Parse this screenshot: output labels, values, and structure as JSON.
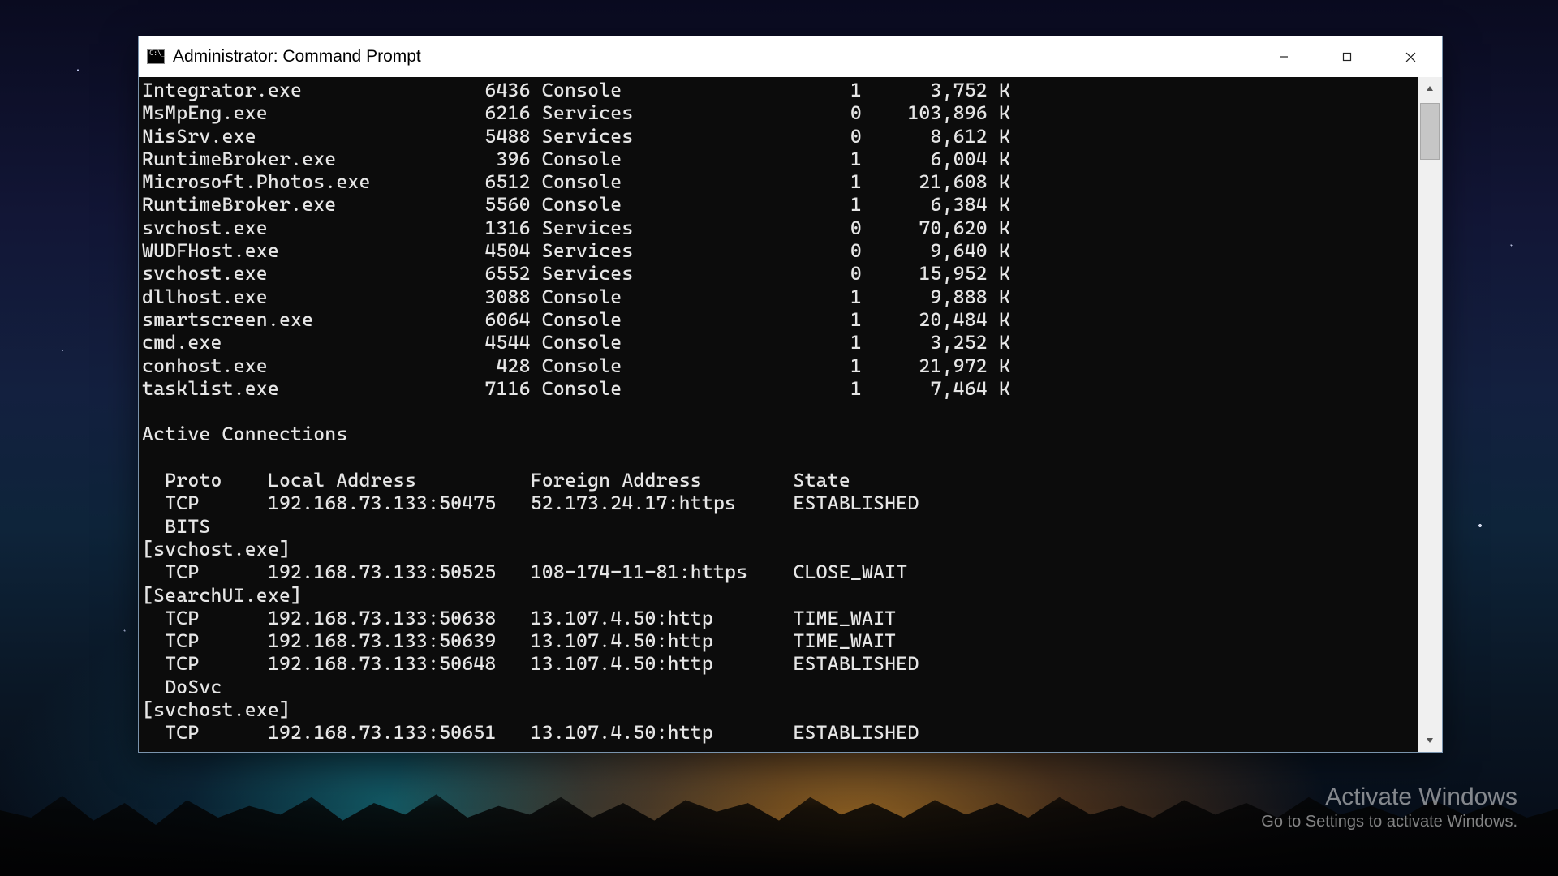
{
  "window": {
    "title": "Administrator: Command Prompt"
  },
  "tasklist": {
    "rows": [
      {
        "name": "Integrator.exe",
        "pid": "6436",
        "session_name": "Console",
        "session_num": "1",
        "mem": "3,752 K"
      },
      {
        "name": "MsMpEng.exe",
        "pid": "6216",
        "session_name": "Services",
        "session_num": "0",
        "mem": "103,896 K"
      },
      {
        "name": "NisSrv.exe",
        "pid": "5488",
        "session_name": "Services",
        "session_num": "0",
        "mem": "8,612 K"
      },
      {
        "name": "RuntimeBroker.exe",
        "pid": "396",
        "session_name": "Console",
        "session_num": "1",
        "mem": "6,004 K"
      },
      {
        "name": "Microsoft.Photos.exe",
        "pid": "6512",
        "session_name": "Console",
        "session_num": "1",
        "mem": "21,608 K"
      },
      {
        "name": "RuntimeBroker.exe",
        "pid": "5560",
        "session_name": "Console",
        "session_num": "1",
        "mem": "6,384 K"
      },
      {
        "name": "svchost.exe",
        "pid": "1316",
        "session_name": "Services",
        "session_num": "0",
        "mem": "70,620 K"
      },
      {
        "name": "WUDFHost.exe",
        "pid": "4504",
        "session_name": "Services",
        "session_num": "0",
        "mem": "9,640 K"
      },
      {
        "name": "svchost.exe",
        "pid": "6552",
        "session_name": "Services",
        "session_num": "0",
        "mem": "15,952 K"
      },
      {
        "name": "dllhost.exe",
        "pid": "3088",
        "session_name": "Console",
        "session_num": "1",
        "mem": "9,888 K"
      },
      {
        "name": "smartscreen.exe",
        "pid": "6064",
        "session_name": "Console",
        "session_num": "1",
        "mem": "20,484 K"
      },
      {
        "name": "cmd.exe",
        "pid": "4544",
        "session_name": "Console",
        "session_num": "1",
        "mem": "3,252 K"
      },
      {
        "name": "conhost.exe",
        "pid": "428",
        "session_name": "Console",
        "session_num": "1",
        "mem": "21,972 K"
      },
      {
        "name": "tasklist.exe",
        "pid": "7116",
        "session_name": "Console",
        "session_num": "1",
        "mem": "7,464 K"
      }
    ]
  },
  "netstat": {
    "title": "Active Connections",
    "header": {
      "proto": "Proto",
      "local": "Local Address",
      "foreign": "Foreign Address",
      "state": "State"
    },
    "lines": [
      {
        "type": "row",
        "proto": "TCP",
        "local": "192.168.73.133:50475",
        "foreign": "52.173.24.17:https",
        "state": "ESTABLISHED"
      },
      {
        "type": "misc",
        "text": " BITS"
      },
      {
        "type": "owner",
        "text": "[svchost.exe]"
      },
      {
        "type": "row",
        "proto": "TCP",
        "local": "192.168.73.133:50525",
        "foreign": "108-174-11-81:https",
        "state": "CLOSE_WAIT"
      },
      {
        "type": "owner",
        "text": "[SearchUI.exe]"
      },
      {
        "type": "row",
        "proto": "TCP",
        "local": "192.168.73.133:50638",
        "foreign": "13.107.4.50:http",
        "state": "TIME_WAIT"
      },
      {
        "type": "row",
        "proto": "TCP",
        "local": "192.168.73.133:50639",
        "foreign": "13.107.4.50:http",
        "state": "TIME_WAIT"
      },
      {
        "type": "row",
        "proto": "TCP",
        "local": "192.168.73.133:50648",
        "foreign": "13.107.4.50:http",
        "state": "ESTABLISHED"
      },
      {
        "type": "misc",
        "text": " DoSvc"
      },
      {
        "type": "owner",
        "text": "[svchost.exe]"
      },
      {
        "type": "row",
        "proto": "TCP",
        "local": "192.168.73.133:50651",
        "foreign": "13.107.4.50:http",
        "state": "ESTABLISHED"
      }
    ]
  },
  "watermark": {
    "line1": "Activate Windows",
    "line2": "Go to Settings to activate Windows."
  },
  "columns": {
    "tasklist": {
      "name": 25,
      "pid": 9,
      "session_name": 17,
      "session_num": 11,
      "mem": 13
    },
    "netstat": {
      "proto_pad": 2,
      "proto": 9,
      "local": 23,
      "foreign": 23
    }
  }
}
